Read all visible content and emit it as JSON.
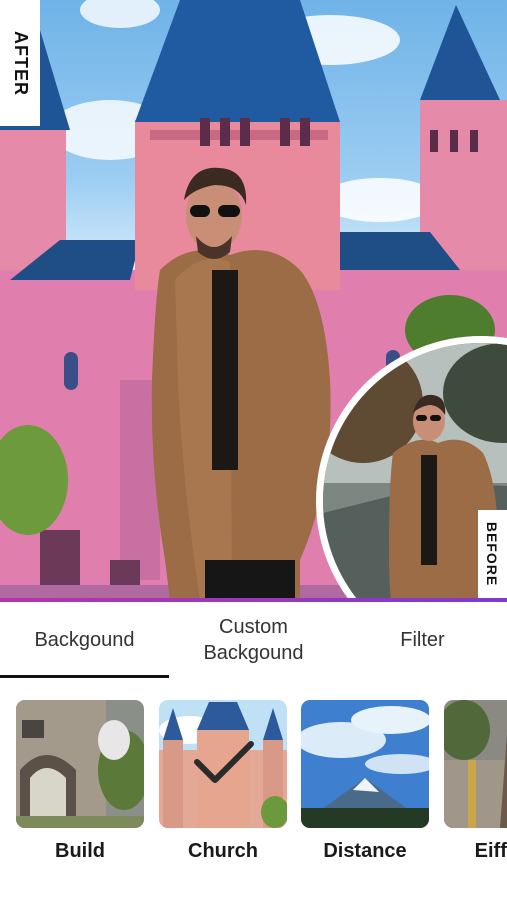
{
  "compare": {
    "after_label": "AFTER",
    "before_label": "BEFORE"
  },
  "tabs": [
    {
      "label": "Backgound",
      "active": true
    },
    {
      "label": "Custom\nBackgound",
      "active": false
    },
    {
      "label": "Filter",
      "active": false
    }
  ],
  "thumbnails": [
    {
      "label": "Build",
      "selected": false
    },
    {
      "label": "Church",
      "selected": true
    },
    {
      "label": "Distance",
      "selected": false
    },
    {
      "label": "Eiffel T",
      "selected": false
    }
  ],
  "colors": {
    "accent": "#b533b0",
    "tab_indicator": "#111111"
  }
}
